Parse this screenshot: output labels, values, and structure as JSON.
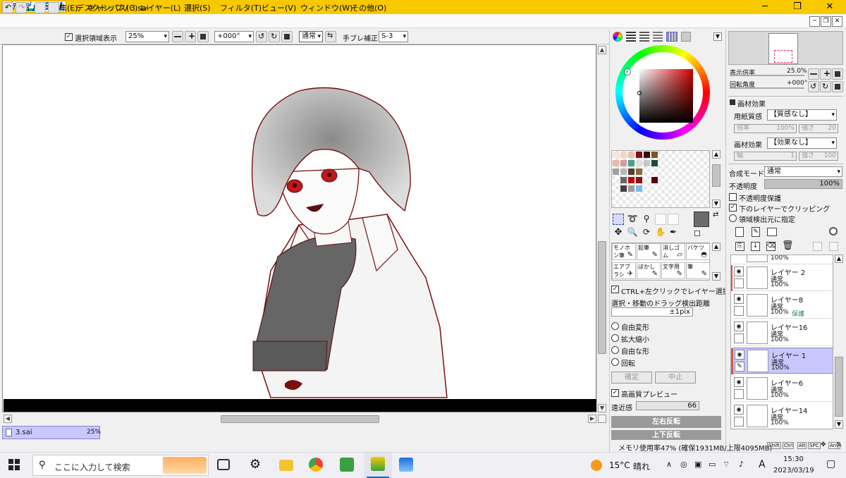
{
  "app": {
    "logo_line1": "Paint Tool",
    "logo_line2": "SAI",
    "title": "デスクトップ / 3.sai"
  },
  "window": {
    "minimize_label": "─",
    "maximize_label": "❐",
    "close_label": "✕"
  },
  "menu": {
    "items": [
      "ファイル(F)",
      "編集(E)",
      "キャンバス(C)",
      "レイヤー(L)",
      "選択(S)",
      "フィルタ(T)",
      "ビュー(V)",
      "ウィンドウ(W)",
      "その他(O)"
    ]
  },
  "mdi": {
    "min": "─",
    "restore": "❐",
    "close": "✕"
  },
  "toolbar": {
    "show_selection_label": "選択領域表示",
    "show_selection_checked": true,
    "zoom_value": "25%",
    "rotation_value": "+000°",
    "blend_value": "通常",
    "stabilizer_label": "手ブレ補正",
    "stabilizer_value": "S-3"
  },
  "navigator": {
    "zoom_label": "表示倍率",
    "zoom_value": "25.0%",
    "angle_label": "回転角度",
    "angle_value": "+000°"
  },
  "texture": {
    "section_label": "画材効果",
    "paper_label": "用紙質感",
    "paper_value": "【質感なし】",
    "magnify_label": "倍率",
    "magnify_value": "100%",
    "strength_label": "強さ",
    "strength_value": "20",
    "effect_label": "画材効果",
    "effect_value": "【効果なし】",
    "width_label": "幅",
    "width_value": "1",
    "strength2_label": "強さ",
    "strength2_value": "100"
  },
  "layer_props": {
    "blend_label": "合成モード",
    "blend_value": "通常",
    "opacity_label": "不透明度",
    "opacity_value": "100%",
    "protect_label": "不透明度保護",
    "clip_label": "下のレイヤーでクリッピング",
    "clip_checked": true,
    "source_label": "領域検出元に指定"
  },
  "layers": [
    {
      "name": "",
      "mode": "",
      "opacity": "100%",
      "extra": "",
      "selected": false
    },
    {
      "name": "レイヤー 2",
      "mode": "通常",
      "opacity": "100%",
      "extra": "",
      "selected": false
    },
    {
      "name": "レイヤー8",
      "mode": "通常",
      "opacity": "100%",
      "extra": "保護",
      "selected": false
    },
    {
      "name": "レイヤー16",
      "mode": "通常",
      "opacity": "100%",
      "extra": "",
      "selected": false
    },
    {
      "name": "レイヤー 1",
      "mode": "通常",
      "opacity": "100%",
      "extra": "",
      "selected": true
    },
    {
      "name": "レイヤー6",
      "mode": "通常",
      "opacity": "100%",
      "extra": "",
      "selected": false
    },
    {
      "name": "レイヤー14",
      "mode": "通常",
      "opacity": "100%",
      "extra": "",
      "selected": false
    }
  ],
  "tools": {
    "cells": [
      "モノホン筆",
      "鉛筆",
      "消しゴム",
      "バケツ",
      "エアブラシ",
      "ぼかし",
      "文字用",
      "筆"
    ]
  },
  "tool_options": {
    "ctrl_select_label": "CTRL+左クリックでレイヤー選択",
    "drag_label": "選択・移動のドラッグ検出距離",
    "drag_value": "±1pix",
    "transform_free": "自由変形",
    "transform_scale": "拡大縮小",
    "transform_free2": "自由な形",
    "transform_rotate": "回転",
    "confirm_label": "確定",
    "cancel_label": "中止",
    "hq_preview_label": "高画質プレビュー",
    "perspective_label": "遠近感",
    "perspective_value": "66",
    "flip_h_label": "左右反転",
    "flip_v_label": "上下反転"
  },
  "document_tab": {
    "name": "3.sai",
    "zoom": "25%"
  },
  "status": {
    "memory": "メモリ使用率47% (確保1931MB/上限4095MB)",
    "keys": [
      "Shift",
      "Ctrl",
      "Alt",
      "SPC",
      "Any"
    ]
  },
  "taskbar": {
    "search_placeholder": "ここに入力して検索",
    "weather_temp": "15°C",
    "weather_text": "晴れ",
    "ime": "A",
    "time": "15:30",
    "date": "2023/03/19"
  },
  "colors": {
    "title_bar": "#f9c900",
    "selection": "#c8c8ff",
    "foreground": "#6b6b6b"
  }
}
